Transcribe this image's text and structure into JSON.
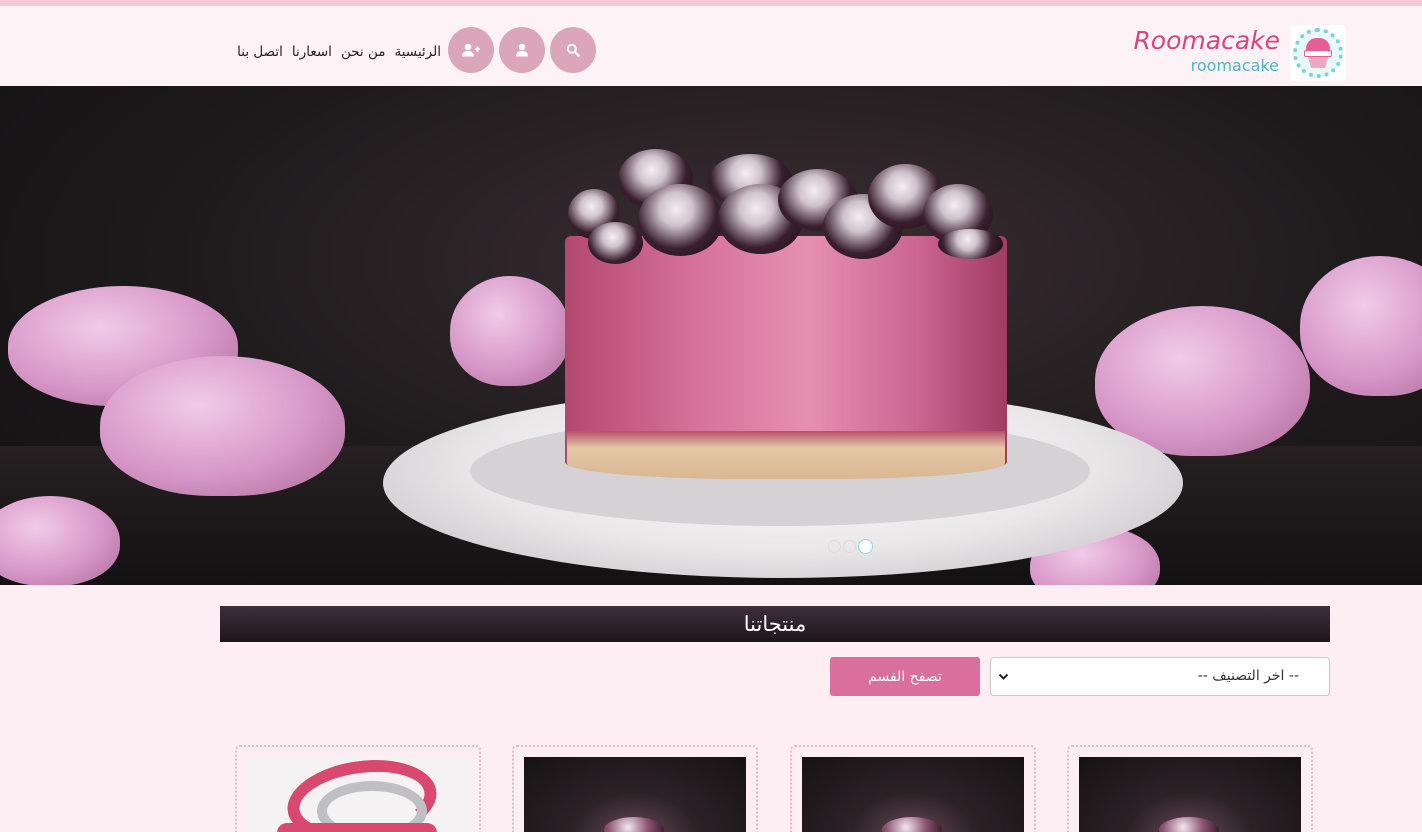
{
  "header": {
    "brand_title": "Roomacake",
    "brand_subtitle": "roomacake",
    "logo_icon": "cupcake-logo-icon",
    "nav": [
      {
        "label": "الرئيسية"
      },
      {
        "label": "من نحن"
      },
      {
        "label": "اسعارنا"
      },
      {
        "label": "اتصل بنا"
      }
    ],
    "icon_buttons": [
      "search-icon",
      "user-icon",
      "user-plus-icon"
    ],
    "accent_color": "#dba6b9",
    "brand_color": "#d8457f",
    "subtitle_color": "#4cb7cc"
  },
  "hero": {
    "slide_count": 3,
    "active_slide": 3
  },
  "products": {
    "title": "منتجاتنا",
    "category_select": {
      "selected": "-- اخر التصنيف --"
    },
    "browse_button": "تصفح القسم",
    "button_color": "#d86f9c"
  }
}
